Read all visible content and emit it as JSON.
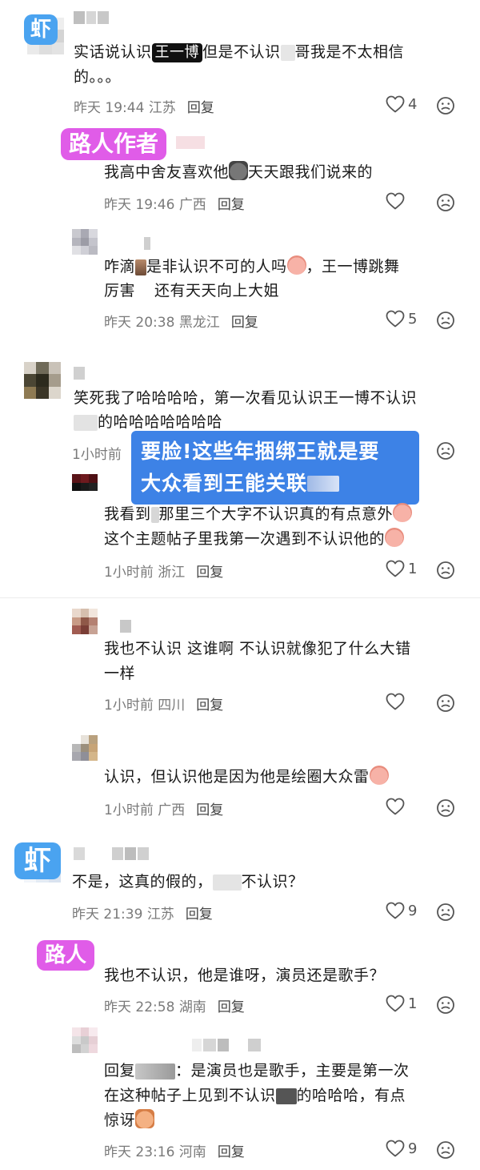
{
  "tags": {
    "shrimp": "虾",
    "passerby_author": "路人作者",
    "passerby": "路人"
  },
  "callout": {
    "line1": "要脸!这些年捆绑王就是要",
    "line2": "大众看到王能关联"
  },
  "comments": [
    {
      "text_a": "实话说认识",
      "mask": "王一博",
      "text_b": "但是不认识",
      "text_c": "哥我是不太相信",
      "text_line2": "的。。。",
      "time": "昨天 19:44",
      "location": "江苏",
      "reply": "回复",
      "likes": "4"
    },
    {
      "text": "我高中舍友喜欢他",
      "text_b": "天天跟我们说来的",
      "time": "昨天 19:46",
      "location": "广西",
      "reply": "回复",
      "likes": ""
    },
    {
      "text": "咋滴",
      "text_b": "是非认识不可的人吗",
      "text_c": "，王一博跳舞",
      "text_line2": "厉害",
      "text_line2_b": "还有天天向上大姐",
      "time": "昨天 20:38",
      "location": "黑龙江",
      "reply": "回复",
      "likes": "5"
    },
    {
      "text": "笑死我了哈哈哈哈，第一次看见认识王一博不认识",
      "text_line2": "的哈哈哈哈哈哈哈",
      "time": "1小时前",
      "location": "",
      "reply": "",
      "likes": ""
    },
    {
      "text": "我看到",
      "text_b": "那里三个大字不认识真的有点意外",
      "text_line2": "这个主题帖子里我第一次遇到不认识他的",
      "time": "1小时前",
      "location": "浙江",
      "reply": "回复",
      "likes": "1"
    },
    {
      "text": "我也不认识 这谁啊 不认识就像犯了什么大错",
      "text_line2": "一样",
      "time": "1小时前",
      "location": "四川",
      "reply": "回复",
      "likes": ""
    },
    {
      "text": "认识，但认识他是因为他是绘圈大众雷",
      "time": "1小时前",
      "location": "广西",
      "reply": "回复",
      "likes": ""
    },
    {
      "text": "不是，这真的假的，",
      "text_b": "不认识？",
      "time": "昨天 21:39",
      "location": "江苏",
      "reply": "回复",
      "likes": "9"
    },
    {
      "text": "我也不认识，他是谁呀，演员还是歌手？",
      "time": "昨天 22:58",
      "location": "湖南",
      "reply": "回复",
      "likes": "1"
    },
    {
      "text": "回复",
      "text_b": "：是演员也是歌手，主要是第一次",
      "text_line2": "在这种帖子上见到不认识",
      "text_line2_b": "的哈哈哈，有点",
      "text_line3": "惊讶",
      "time": "昨天 23:16",
      "location": "河南",
      "reply": "回复",
      "likes": "9"
    }
  ],
  "icons": {
    "like": "heart-outline-icon",
    "dislike": "frown-face-icon"
  },
  "colors": {
    "tag_blue": "#4aa3f0",
    "tag_pink": "#e05ce8",
    "callout": "#3d82e6",
    "meta_gray": "#7a7a7a"
  }
}
